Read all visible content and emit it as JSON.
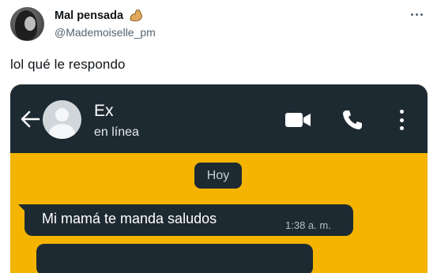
{
  "tweet": {
    "display_name": "Mal pensada",
    "emoji": "flexed-biceps-emoji",
    "handle": "@Mademoiselle_pm",
    "text": "lol qué le respondo",
    "more_icon": "more-horizontal-icon"
  },
  "chat": {
    "contact_name": "Ex",
    "contact_status": "en línea",
    "header_icons": [
      "back-arrow-icon",
      "video-call-icon",
      "phone-icon",
      "more-vertical-icon"
    ],
    "date_chip": "Hoy",
    "messages": [
      {
        "text": "Mi mamá te manda saludos",
        "time": "1:38 a. m."
      }
    ]
  },
  "colors": {
    "chat_header": "#1e2a32",
    "chat_background": "#f4b400",
    "bubble": "#1e2a32",
    "handle_gray": "#536471"
  }
}
